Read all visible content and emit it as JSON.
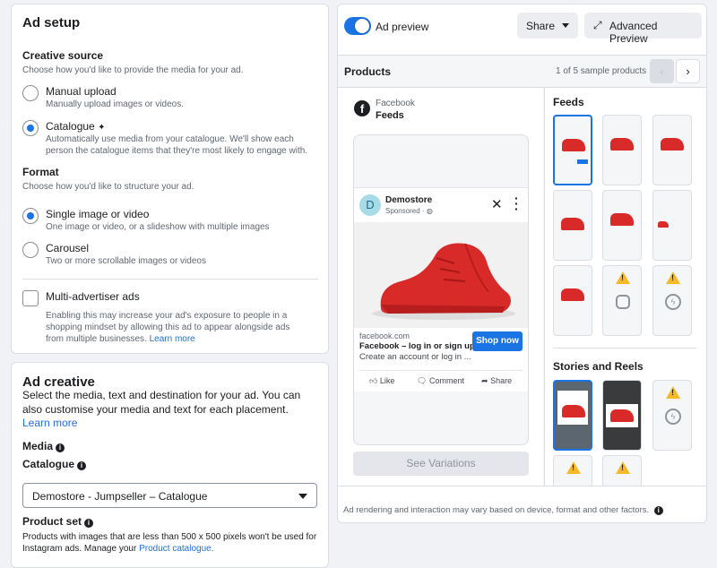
{
  "ad_setup": {
    "title": "Ad setup",
    "creative_source": {
      "title": "Creative source",
      "desc": "Choose how you'd like to provide the media for your ad.",
      "options": [
        {
          "label": "Manual upload",
          "desc": "Manually upload images or videos.",
          "selected": false
        },
        {
          "label": "Catalogue",
          "desc": "Automatically use media from your catalogue. We'll show each person the catalogue items that they're most likely to engage with.",
          "selected": true
        }
      ]
    },
    "format": {
      "title": "Format",
      "desc": "Choose how you'd like to structure your ad.",
      "options": [
        {
          "label": "Single image or video",
          "desc": "One image or video, or a slideshow with multiple images",
          "selected": true
        },
        {
          "label": "Carousel",
          "desc": "Two or more scrollable images or videos",
          "selected": false
        }
      ]
    },
    "multi_advertiser": {
      "label": "Multi-advertiser ads",
      "desc": "Enabling this may increase your ad's exposure to people in a shopping mindset by allowing this ad to appear alongside ads from multiple businesses.",
      "learn_more": "Learn more",
      "checked": false
    }
  },
  "ad_creative": {
    "title": "Ad creative",
    "desc": "Select the media, text and destination for your ad. You can also customise your media and text for each placement.",
    "learn_more": "Learn more",
    "media_label": "Media",
    "catalogue_label": "Catalogue",
    "catalogue_value": "Demostore - Jumpseller – Catalogue",
    "product_set_label": "Product set",
    "product_set_desc": "Products with images that are less than 500 x 500 pixels won't be used for Instagram ads. Manage your",
    "product_catalogue_link": "Product catalogue."
  },
  "preview": {
    "toggle_label": "Ad preview",
    "toggle_on": true,
    "share_label": "Share",
    "advanced_label": "Advanced Preview",
    "products_label": "Products",
    "pager_text": "1 of 5 sample products",
    "platform": "Facebook",
    "placement": "Feeds",
    "post": {
      "avatar_letter": "D",
      "page_name": "Demostore",
      "sponsored": "Sponsored",
      "domain": "facebook.com",
      "headline": "Facebook – log in or sign up",
      "description": "Create an account or log in ...",
      "cta": "Shop now",
      "like": "Like",
      "comment": "Comment",
      "share": "Share"
    },
    "see_variations": "See Variations",
    "feeds_title": "Feeds",
    "stories_title": "Stories and Reels",
    "footer_note": "Ad rendering and interaction may vary based on device, format and other factors.",
    "colors": {
      "accent": "#1b74e4",
      "shoe": "#d92a2a",
      "warning": "#f7b928"
    }
  }
}
